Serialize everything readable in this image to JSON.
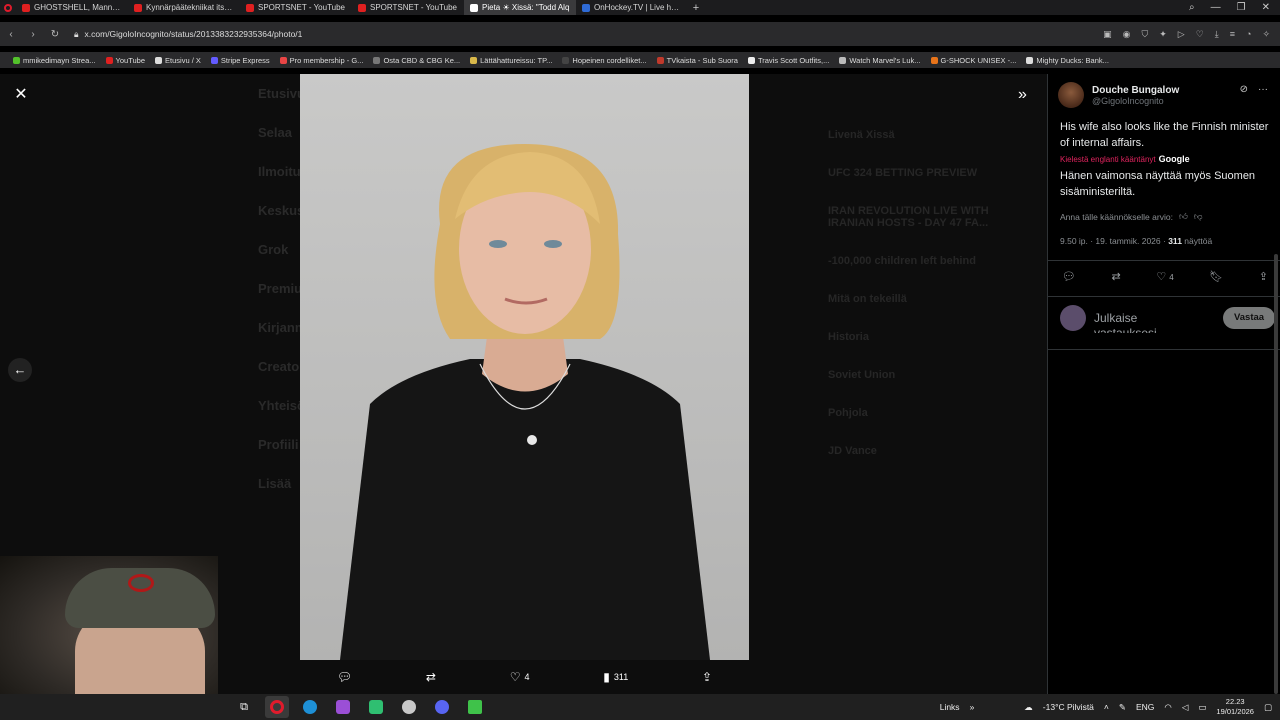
{
  "tabs": [
    {
      "label": "GHOSTSHELL, Mannequin",
      "favicon": "youtube-icon"
    },
    {
      "label": "Kynnärpäätekniikat itsepu",
      "favicon": "youtube-icon"
    },
    {
      "label": "SPORTSNET - YouTube",
      "favicon": "youtube-icon"
    },
    {
      "label": "SPORTSNET - YouTube",
      "favicon": "youtube-icon"
    },
    {
      "label": "Pieta ☀ Xissä: \"Todd Alq",
      "favicon": "x-icon",
      "active": true
    },
    {
      "label": "OnHockey.TV | Live hocke",
      "favicon": "onhockey-icon"
    }
  ],
  "address": {
    "url": "x.com/GigoloIncognito/status/2013383232935364/photo/1"
  },
  "bookmarks": [
    "mmikedimayn Strea...",
    "YouTube",
    "Etusivu / X",
    "Stripe Express",
    "Pro membership - G...",
    "Osta CBD & CBG Ke...",
    "Lättähattureissu: TP...",
    "Hopeinen cordelliket...",
    "TVkaista - Sub Suora",
    "Travis Scott Outfits,...",
    "Watch Marvel's Luk...",
    "G-SHOCK UNISEX -...",
    "Mighty Ducks: Bank..."
  ],
  "viewer": {
    "close_icon": "close-icon",
    "expand_icon": "double-chevron-right-icon",
    "prev_icon": "arrow-left-icon",
    "ghost_nav": [
      "Etusivu",
      "Selaa",
      "Ilmoitukset",
      "Keskustelu",
      "Grok",
      "Premium",
      "Kirjanmerkit",
      "Creator",
      "Yhteisöt",
      "Profiili",
      "Lisää"
    ],
    "ghost_right": [
      "Livenä Xissä",
      "UFC 324 BETTING PREVIEW",
      "IRAN REVOLUTION LIVE WITH IRANIAN HOSTS - DAY 47 FA...",
      "-100,000 children left behind",
      "Mitä on tekeillä",
      "Historia",
      "Soviet Union",
      "Pohjola",
      "JD Vance"
    ],
    "actions": {
      "reply_count": "",
      "retweet_count": "",
      "like_count": "4",
      "views_count": "311"
    }
  },
  "tweet": {
    "display_name": "Douche Bungalow",
    "username": "@GigoloIncognito",
    "text": "His wife also looks like the Finnish minister of internal affairs.",
    "translated_label": "Kielestä englanti kääntänyt",
    "translator": "Google",
    "translated_text": "Hänen vaimonsa näyttää myös Suomen sisäministeriltä.",
    "rate_prompt": "Anna tälle käännökselle arvio:",
    "timestamp": "9.50 ip. · 19. tammik. 2026 ·",
    "views": "311",
    "views_label": "näyttöä",
    "like_count": "4",
    "reply_placeholder": "Julkaise vastauksesi",
    "reply_button": "Vastaa"
  },
  "taskbar": {
    "links_label": "Links",
    "weather": "-13°C Pilvistä",
    "lang": "ENG",
    "time": "22.23",
    "date": "19/01/2026"
  },
  "colors": {
    "accent": "#e0245e",
    "reply_button": "#787a7a",
    "opera_red": "#e01b2c"
  }
}
